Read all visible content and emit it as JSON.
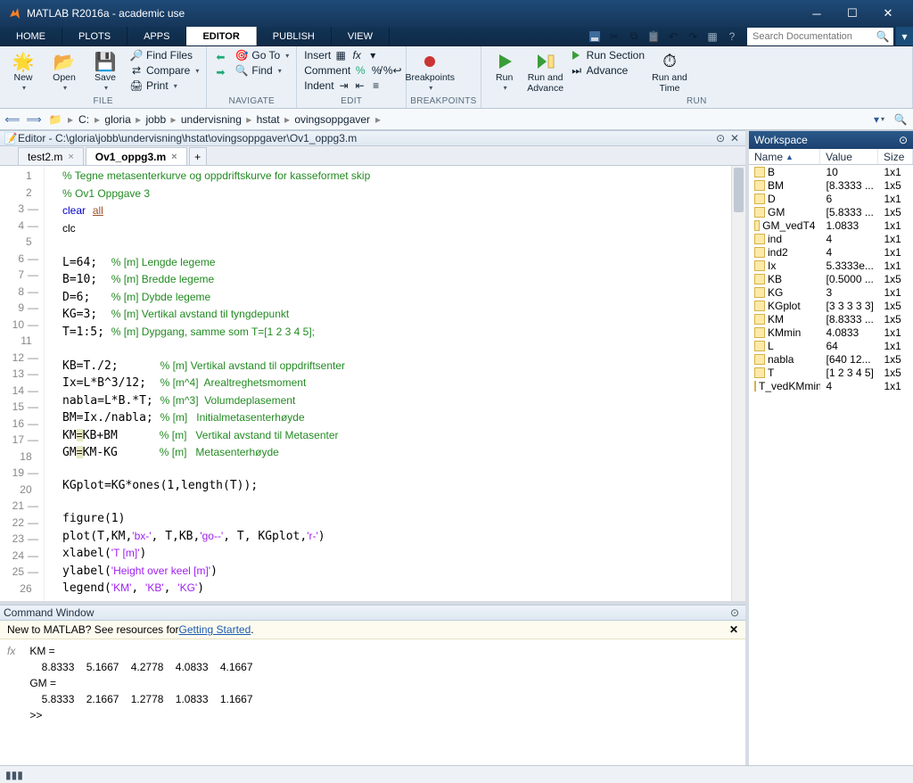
{
  "window": {
    "title": "MATLAB R2016a - academic use"
  },
  "topTabs": {
    "items": [
      "HOME",
      "PLOTS",
      "APPS",
      "EDITOR",
      "PUBLISH",
      "VIEW"
    ],
    "activeIndex": 3,
    "searchPlaceholder": "Search Documentation"
  },
  "ribbon": {
    "groups": {
      "file": {
        "label": "FILE",
        "new": "New",
        "open": "Open",
        "save": "Save",
        "findFiles": "Find Files",
        "compare": "Compare",
        "print": "Print"
      },
      "navigate": {
        "label": "NAVIGATE",
        "goto": "Go To",
        "find": "Find"
      },
      "edit": {
        "label": "EDIT",
        "insert": "Insert",
        "comment": "Comment",
        "indent": "Indent"
      },
      "breakpoints": {
        "label": "BREAKPOINTS",
        "btn": "Breakpoints"
      },
      "run": {
        "label": "RUN",
        "run": "Run",
        "runAdvance": "Run and\nAdvance",
        "runSection": "Run Section",
        "advance": "Advance",
        "runTime": "Run and\nTime"
      }
    }
  },
  "address": {
    "drive": "C:",
    "segments": [
      "gloria",
      "jobb",
      "undervisning",
      "hstat",
      "ovingsoppgaver"
    ]
  },
  "editorPanel": {
    "title": "Editor - C:\\gloria\\jobb\\undervisning\\hstat\\ovingsoppgaver\\Ov1_oppg3.m",
    "tabs": [
      "test2.m",
      "Ov1_oppg3.m"
    ],
    "activeTab": 1
  },
  "code": {
    "lines": [
      {
        "n": 1,
        "dash": false,
        "html": "<span class='cm'>% Tegne metasenterkurve og oppdriftskurve for kasseformet skip</span>"
      },
      {
        "n": 2,
        "dash": false,
        "html": "<span class='cm'>% Ov1 Oppgave 3</span>"
      },
      {
        "n": 3,
        "dash": true,
        "html": "<span class='kw'>clear</span> <span style='text-decoration:underline;color:#a0522d'>all</span>"
      },
      {
        "n": 4,
        "dash": true,
        "html": "<span class='id'>clc</span>"
      },
      {
        "n": 5,
        "dash": false,
        "html": ""
      },
      {
        "n": 6,
        "dash": true,
        "html": "L=64;  <span class='cm'>% [m] Lengde legeme</span>"
      },
      {
        "n": 7,
        "dash": true,
        "html": "B=10;  <span class='cm'>% [m] Bredde legeme</span>"
      },
      {
        "n": 8,
        "dash": true,
        "html": "D=6;   <span class='cm'>% [m] Dybde legeme</span>"
      },
      {
        "n": 9,
        "dash": true,
        "html": "KG=3;  <span class='cm'>% [m] Vertikal avstand til tyngdepunkt</span>"
      },
      {
        "n": 10,
        "dash": true,
        "html": "T=1:5; <span class='cm'>% [m] Dypgang, samme som T=[1 2 3 4 5];</span>"
      },
      {
        "n": 11,
        "dash": false,
        "html": ""
      },
      {
        "n": 12,
        "dash": true,
        "html": "KB=T./2;      <span class='cm'>% [m] Vertikal avstand til oppdriftsenter</span>"
      },
      {
        "n": 13,
        "dash": true,
        "html": "Ix=L*B^3/12;  <span class='cm'>% [m^4]  Arealtreghetsmoment</span>"
      },
      {
        "n": 14,
        "dash": true,
        "html": "nabla=L*B.*T; <span class='cm'>% [m^3]  Volumdeplasement</span>"
      },
      {
        "n": 15,
        "dash": true,
        "html": "BM=Ix./nabla; <span class='cm'>% [m]   Initialmetasenterhøyde</span>"
      },
      {
        "n": 16,
        "dash": true,
        "html": "KM<span style='background:#e8e8c0'>=</span>KB+BM      <span class='cm'>% [m]   Vertikal avstand til Metasenter</span>"
      },
      {
        "n": 17,
        "dash": true,
        "html": "GM<span style='background:#e8e8c0'>=</span>KM-KG      <span class='cm'>% [m]   Metasenterhøyde</span>"
      },
      {
        "n": 18,
        "dash": false,
        "html": ""
      },
      {
        "n": 19,
        "dash": true,
        "html": "KGplot=KG*ones(1,length(T));"
      },
      {
        "n": 20,
        "dash": false,
        "html": ""
      },
      {
        "n": 21,
        "dash": true,
        "html": "figure(1)"
      },
      {
        "n": 22,
        "dash": true,
        "html": "plot(T,KM,<span class='str'>'bx-'</span>, T,KB,<span class='str'>'go--'</span>, T, KGplot,<span class='str'>'r-'</span>)"
      },
      {
        "n": 23,
        "dash": true,
        "html": "xlabel(<span class='str'>'T [m]'</span>)"
      },
      {
        "n": 24,
        "dash": true,
        "html": "ylabel(<span class='str'>'Height over keel [m]'</span>)"
      },
      {
        "n": 25,
        "dash": true,
        "html": "legend(<span class='str'>'KM'</span>, <span class='str'>'KB'</span>, <span class='str'>'KG'</span>)"
      },
      {
        "n": 26,
        "dash": false,
        "html": ""
      }
    ]
  },
  "commandWindow": {
    "title": "Command Window",
    "bannerPrefix": "New to MATLAB? See resources for ",
    "bannerLink": "Getting Started",
    "bannerSuffix": ".",
    "output": " KM =\n     8.8333    5.1667    4.2778    4.0833    4.1667\n GM =\n     5.8333    2.1667    1.2778    1.0833    1.1667\n >> "
  },
  "workspace": {
    "title": "Workspace",
    "columns": {
      "name": "Name",
      "value": "Value",
      "size": "Size"
    },
    "sortAsc": true,
    "vars": [
      {
        "name": "B",
        "value": "10",
        "size": "1x1"
      },
      {
        "name": "BM",
        "value": "[8.3333 ...",
        "size": "1x5"
      },
      {
        "name": "D",
        "value": "6",
        "size": "1x1"
      },
      {
        "name": "GM",
        "value": "[5.8333 ...",
        "size": "1x5"
      },
      {
        "name": "GM_vedT4",
        "value": "1.0833",
        "size": "1x1"
      },
      {
        "name": "ind",
        "value": "4",
        "size": "1x1"
      },
      {
        "name": "ind2",
        "value": "4",
        "size": "1x1"
      },
      {
        "name": "Ix",
        "value": "5.3333e...",
        "size": "1x1"
      },
      {
        "name": "KB",
        "value": "[0.5000 ...",
        "size": "1x5"
      },
      {
        "name": "KG",
        "value": "3",
        "size": "1x1"
      },
      {
        "name": "KGplot",
        "value": "[3 3 3 3 3]",
        "size": "1x5"
      },
      {
        "name": "KM",
        "value": "[8.8333 ...",
        "size": "1x5"
      },
      {
        "name": "KMmin",
        "value": "4.0833",
        "size": "1x1"
      },
      {
        "name": "L",
        "value": "64",
        "size": "1x1"
      },
      {
        "name": "nabla",
        "value": "[640 12...",
        "size": "1x5"
      },
      {
        "name": "T",
        "value": "[1 2 3 4 5]",
        "size": "1x5"
      },
      {
        "name": "T_vedKMmin",
        "value": "4",
        "size": "1x1"
      }
    ]
  }
}
